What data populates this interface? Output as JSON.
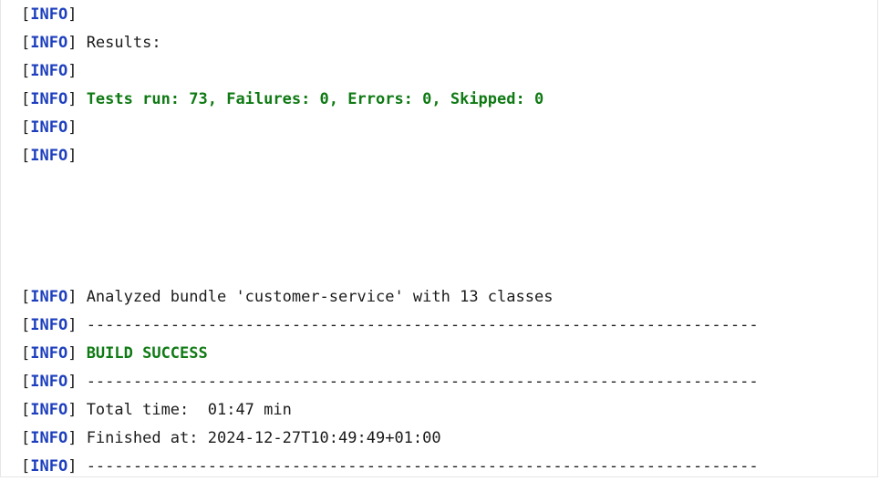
{
  "console": {
    "lines": [
      {
        "level": "INFO",
        "text": ""
      },
      {
        "level": "INFO",
        "text": "Results:"
      },
      {
        "level": "INFO",
        "text": ""
      },
      {
        "level": "INFO",
        "text": "Tests run: 73, Failures: 0, Errors: 0, Skipped: 0"
      },
      {
        "level": "INFO",
        "text": ""
      },
      {
        "level": "INFO",
        "text": ""
      },
      {
        "level": "INFO",
        "text": "Analyzed bundle 'customer-service' with 13 classes"
      },
      {
        "level": "INFO",
        "text": "------------------------------------------------------------------------"
      },
      {
        "level": "INFO",
        "text": "BUILD SUCCESS"
      },
      {
        "level": "INFO",
        "text": "------------------------------------------------------------------------"
      },
      {
        "level": "INFO",
        "text": "Total time:  01:47 min"
      },
      {
        "level": "INFO",
        "text": "Finished at: 2024-12-27T10:49:49+01:00"
      },
      {
        "level": "INFO",
        "text": "------------------------------------------------------------------------"
      }
    ]
  },
  "colors": {
    "level": "#1d3fbd",
    "success": "#0f7a14",
    "text": "#1b1b1b"
  }
}
